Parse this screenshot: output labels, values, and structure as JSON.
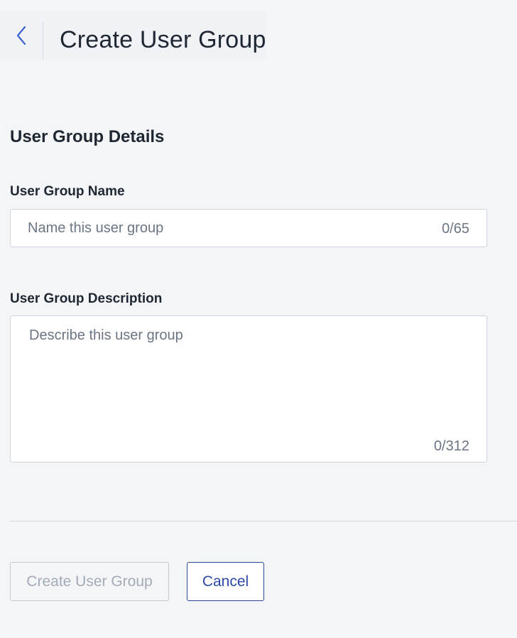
{
  "header": {
    "back_icon": "chevron-left-icon",
    "title": "Create User Group"
  },
  "form": {
    "section_title": "User Group Details",
    "name_field": {
      "label": "User Group Name",
      "value": "",
      "placeholder": "Name this user group",
      "counter": "0/65"
    },
    "description_field": {
      "label": "User Group Description",
      "value": "",
      "placeholder": "Describe this user group",
      "counter": "0/312"
    }
  },
  "actions": {
    "create_label": "Create User Group",
    "create_disabled": true,
    "cancel_label": "Cancel"
  },
  "colors": {
    "page_background": "#f4f5f7",
    "accent": "#2b49a8",
    "back_icon": "#3d63d6",
    "disabled_text": "#a3abb8"
  }
}
